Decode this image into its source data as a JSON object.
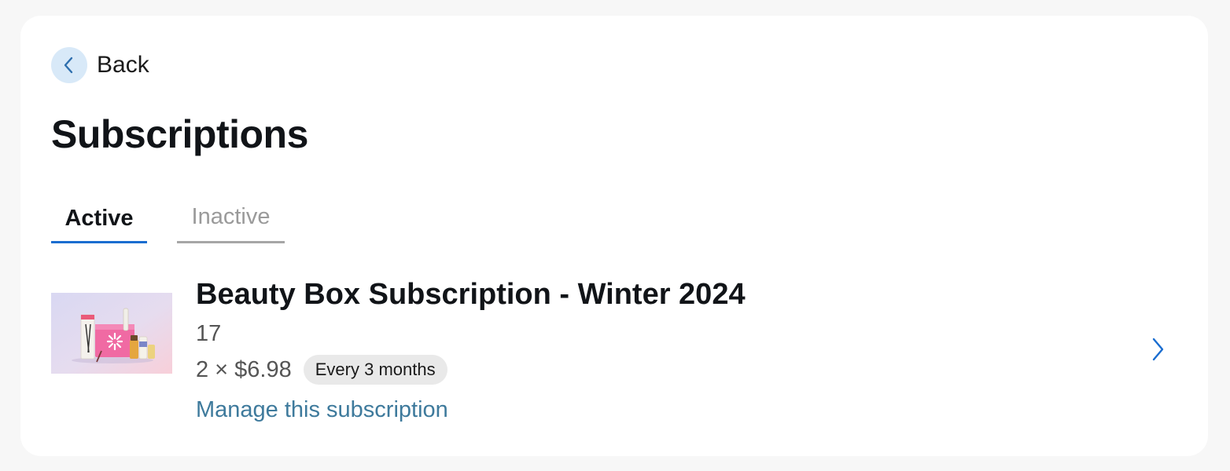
{
  "back": {
    "label": "Back"
  },
  "page": {
    "title": "Subscriptions"
  },
  "tabs": [
    {
      "label": "Active"
    },
    {
      "label": "Inactive"
    }
  ],
  "subscription": {
    "title": "Beauty Box Subscription - Winter 2024",
    "quantity_line": "17",
    "price": "2 × $6.98",
    "frequency_badge": "Every 3 months",
    "manage_link": "Manage this subscription"
  },
  "colors": {
    "accent": "#1a6dd0",
    "link": "#3e7a9c",
    "back_circle": "#d8e9f8",
    "badge_bg": "#e9e9e9"
  },
  "icons": {
    "back": "chevron-left-icon",
    "row": "chevron-right-icon"
  }
}
